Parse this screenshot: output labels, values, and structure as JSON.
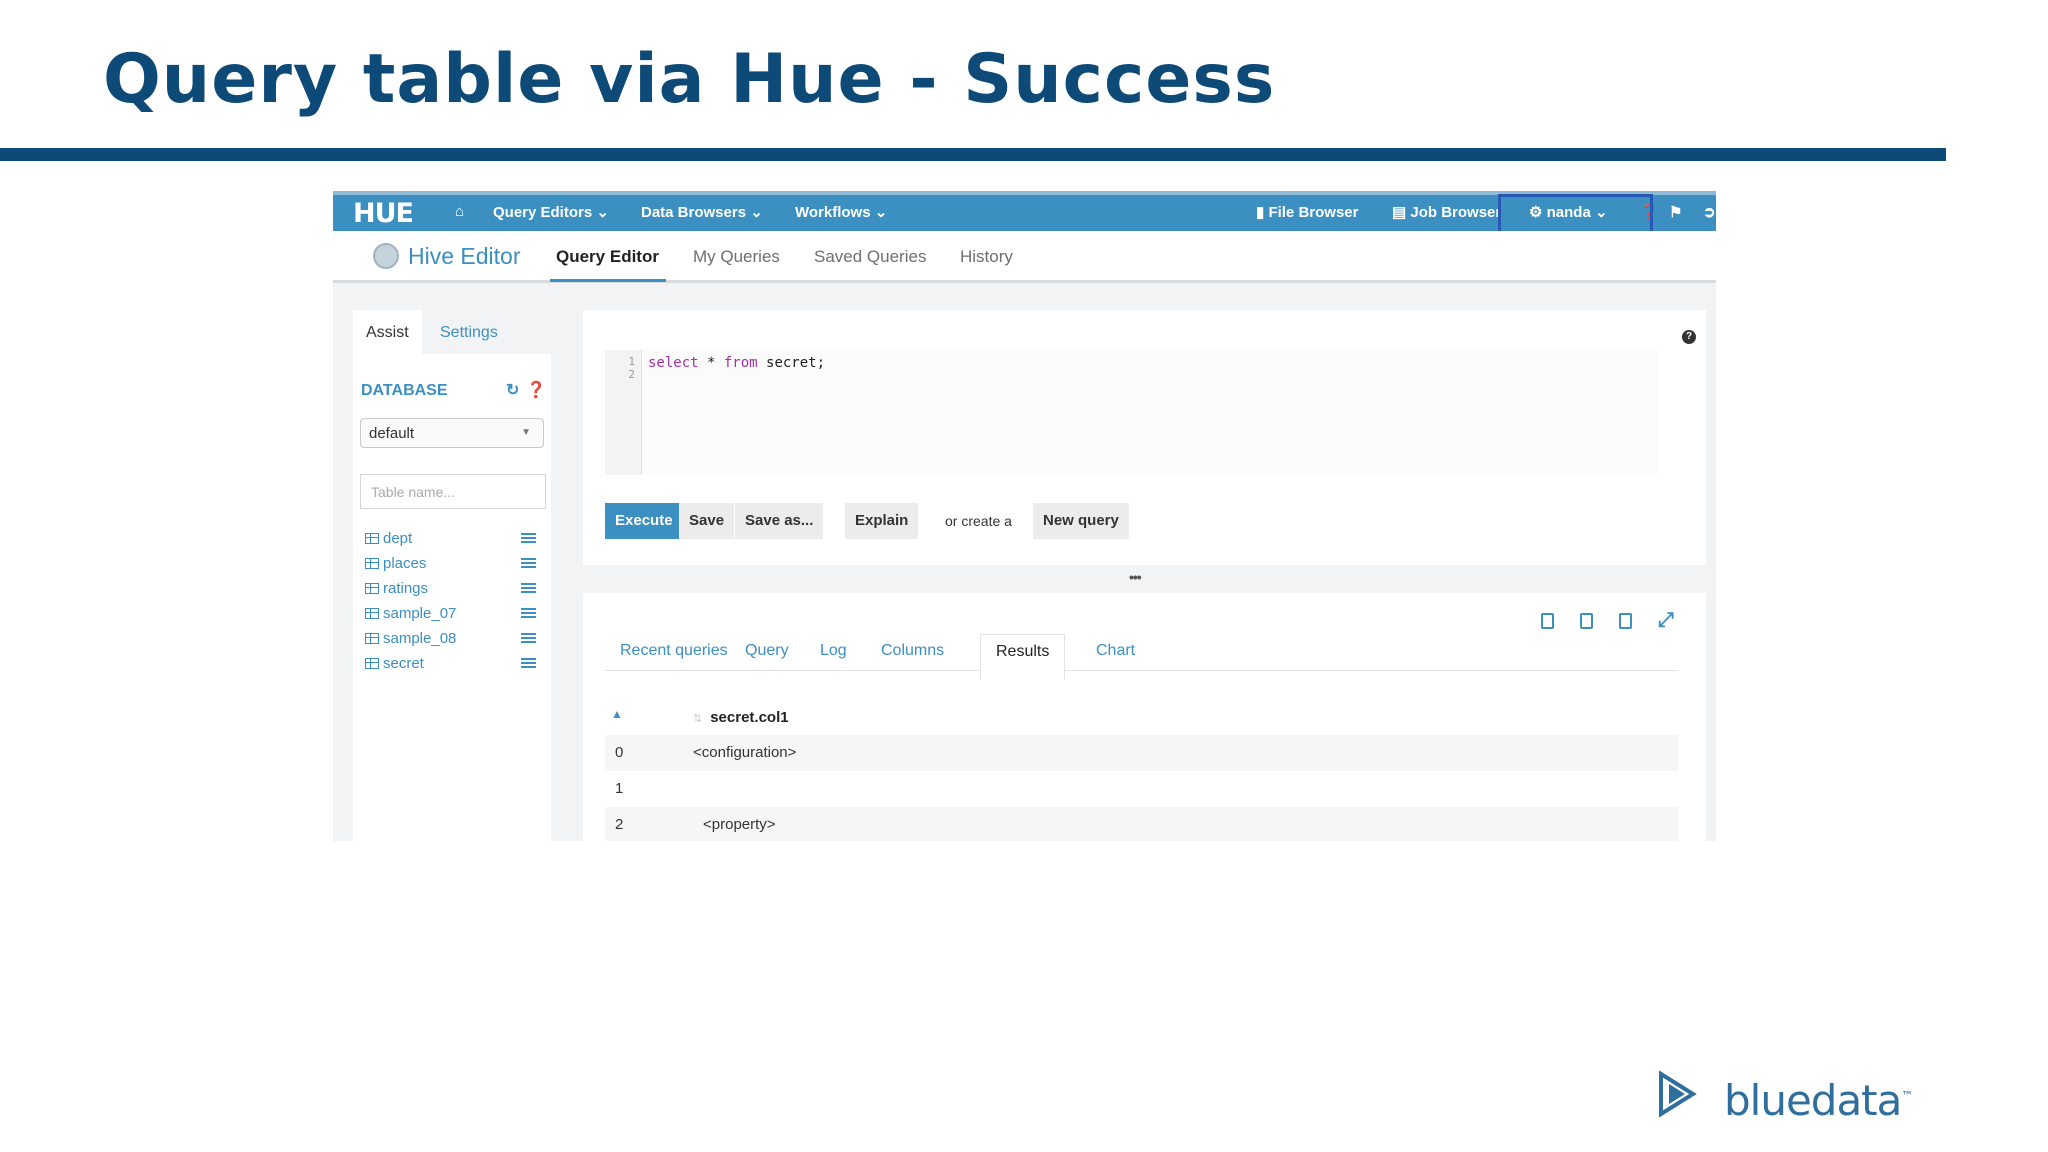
{
  "slide": {
    "title": "Query table via Hue - Success"
  },
  "hue": {
    "logo": "HUE",
    "nav": {
      "query_editors": "Query Editors",
      "data_browsers": "Data Browsers",
      "workflows": "Workflows",
      "file_browser": "File Browser",
      "job_browser": "Job Browser",
      "user": "nanda"
    },
    "subnav": {
      "title": "Hive Editor",
      "tabs": [
        "Query Editor",
        "My Queries",
        "Saved Queries",
        "History"
      ],
      "active_tab": "Query Editor"
    },
    "assist": {
      "tabs": [
        "Assist",
        "Settings"
      ],
      "database_label": "DATABASE",
      "database_value": "default",
      "table_filter_placeholder": "Table name...",
      "tables": [
        "dept",
        "places",
        "ratings",
        "sample_07",
        "sample_08",
        "secret"
      ]
    },
    "editor": {
      "line_numbers": [
        "1",
        "2"
      ],
      "keyword_select": "select",
      "star": " * ",
      "keyword_from": "from",
      "rest": " secret;",
      "buttons": {
        "execute": "Execute",
        "save": "Save",
        "save_as": "Save as...",
        "explain": "Explain",
        "or_create": "or create a",
        "new_query": "New query"
      }
    },
    "results": {
      "tabs": [
        "Recent queries",
        "Query",
        "Log",
        "Columns",
        "Results",
        "Chart"
      ],
      "active_tab": "Results",
      "column_header": "secret.col1",
      "rows": [
        {
          "index": "0",
          "value": "<configuration>"
        },
        {
          "index": "1",
          "value": ""
        },
        {
          "index": "2",
          "value": "<property>"
        }
      ]
    }
  },
  "brand": {
    "name": "bluedata",
    "tm": "™"
  },
  "colors": {
    "title": "#0e4a78",
    "hue_blue": "#3b8fc1",
    "highlight": "#2857b4"
  }
}
